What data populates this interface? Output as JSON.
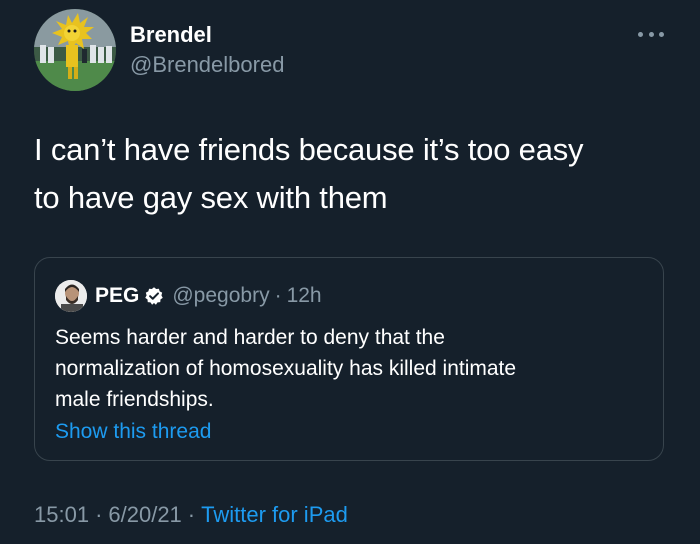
{
  "author": {
    "display_name": "Brendel",
    "handle": "@Brendelbored"
  },
  "tweet": {
    "text_line_1": "I can’t have friends because it’s too easy",
    "text_line_2": "to have gay sex with them"
  },
  "quoted_tweet": {
    "display_name": "PEG",
    "handle": "@pegobry",
    "separator": "·",
    "time": "12h",
    "text_line_1": "Seems harder and harder to deny that the",
    "text_line_2": "normalization of homosexuality has killed intimate",
    "text_line_3": "male friendships.",
    "show_thread_label": "Show this thread"
  },
  "meta": {
    "time": "15:01",
    "separator": "·",
    "date": "6/20/21",
    "source": "Twitter for iPad"
  },
  "icons": {
    "more": "more-horizontal-icon",
    "verified": "verified-badge-icon"
  },
  "colors": {
    "background": "#15202b",
    "secondary_text": "#8899a6",
    "link": "#1d9bf0",
    "border": "#38444d"
  }
}
